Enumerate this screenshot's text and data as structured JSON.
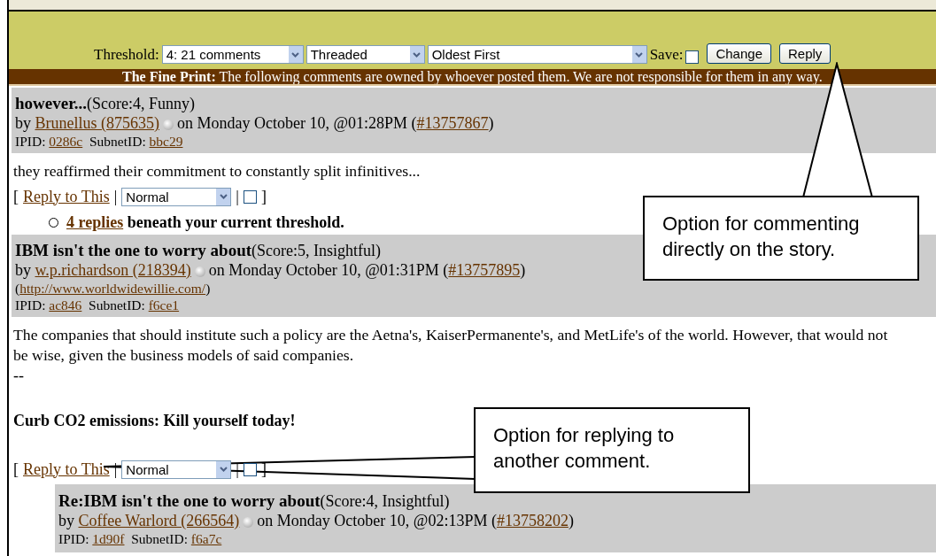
{
  "controls": {
    "threshold_label": "Threshold:",
    "selects": [
      {
        "value": "4: 21 comments"
      },
      {
        "value": "Threaded"
      },
      {
        "value": "Oldest First"
      }
    ],
    "save_label": "Save:",
    "save_checked": false,
    "buttons": [
      "Change",
      "Reply"
    ]
  },
  "fine_print": "**The Fine Print:** The following comments are owned by whoever posted them. We are not responsible for them in any way.",
  "comments": [
    {
      "title": "however...",
      "score": "(Score:4, Funny)",
      "by": "by",
      "author": "Brunellus (875635)",
      "date": "on Monday October 10, @01:28PM",
      "cid_brackets": [
        "(",
        ")"
      ],
      "cid": "#13757867",
      "ipid_label": "IPID:",
      "ipid": "0286c",
      "subnet_label": "SubnetID:",
      "subnet": "bbc29",
      "body": [
        "they reaffirmed their commitment to constantly split infinitives..."
      ],
      "action_marks": [
        "[",
        "|",
        "|",
        "]"
      ],
      "reply_link": "Reply to This",
      "moderation": "Normal",
      "checked": false,
      "replies_link": "4 replies",
      "replies_text": "beneath your current threshold."
    },
    {
      "title": "IBM isn't the one to worry about",
      "score": "(Score:5, Insightful)",
      "by": "by",
      "author": "w.p.richardson (218394)",
      "date": "on Monday October 10, @01:31PM",
      "cid_brackets": [
        "(",
        ")"
      ],
      "cid": "#13757895",
      "homepage_brackets": [
        "(",
        ")"
      ],
      "homepage": "http://www.worldwidewillie.com/",
      "ipid_label": "IPID:",
      "ipid": "ac846",
      "subnet_label": "SubnetID:",
      "subnet": "f6ce1",
      "body": [
        "The companies that should institute such a policy are the Aetna's, KaiserPermanente's, and MetLife's of the world. However, that would not",
        "be wise, given the business models of said companies."
      ],
      "separator": "--",
      "signature": "Curb CO2 emissions: Kill yourself today!",
      "action_marks": [
        "[",
        "|",
        "|",
        "]"
      ],
      "reply_link": "Reply to This",
      "moderation": "Normal",
      "checked": false,
      "children": [
        {
          "title": "Re:IBM isn't the one to worry about",
          "score": "(Score:4, Insightful)",
          "by": "by",
          "author": "Coffee Warlord (266564)",
          "date": "on Monday October 10, @02:13PM",
          "cid_brackets": [
            "(",
            ")"
          ],
          "cid": "#13758202",
          "ipid_label": "IPID:",
          "ipid": "1d90f",
          "subnet_label": "SubnetID:",
          "subnet": "f6a7c"
        }
      ]
    }
  ],
  "callouts": [
    {
      "text": "Option for commenting directly on the story."
    },
    {
      "text": "Option for replying to another comment."
    }
  ]
}
